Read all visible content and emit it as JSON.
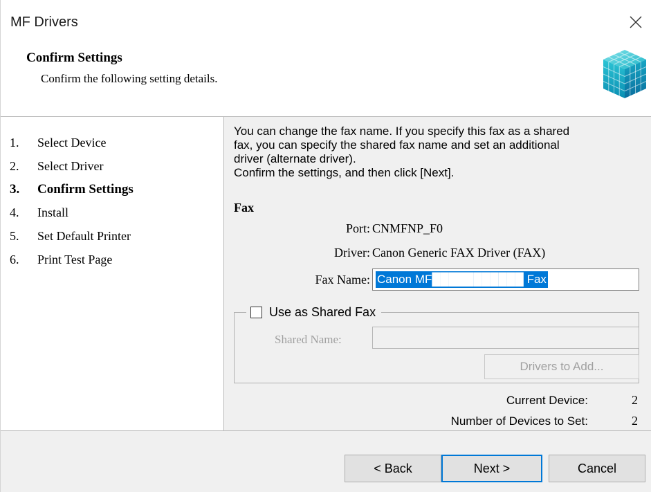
{
  "window": {
    "title": "MF Drivers"
  },
  "header": {
    "title": "Confirm Settings",
    "subtitle": "Confirm the following setting details."
  },
  "steps": [
    {
      "num": "1.",
      "label": "Select Device",
      "active": false
    },
    {
      "num": "2.",
      "label": "Select Driver",
      "active": false
    },
    {
      "num": "3.",
      "label": "Confirm Settings",
      "active": true
    },
    {
      "num": "4.",
      "label": "Install",
      "active": false
    },
    {
      "num": "5.",
      "label": "Set Default Printer",
      "active": false
    },
    {
      "num": "6.",
      "label": "Print Test Page",
      "active": false
    }
  ],
  "content": {
    "intro_line1": "You can change the fax name. If you specify this fax as a shared",
    "intro_line2": "fax, you can specify the shared fax name and set an additional",
    "intro_line3": "driver (alternate driver).",
    "intro_line4": "Confirm the settings, and then click [Next].",
    "fax_heading": "Fax",
    "port_label": "Port:",
    "port_value": "CNMFNP_F0",
    "driver_label": "Driver:",
    "driver_value": "Canon Generic FAX Driver (FAX)",
    "fax_name_label": "Fax Name:",
    "fax_name_value": "Canon MF███████████ Fax",
    "shared_checkbox_label": "Use as Shared Fax",
    "shared_checked": false,
    "shared_name_label": "Shared Name:",
    "shared_name_value": "",
    "drivers_to_add_label": "Drivers to Add...",
    "current_device_label": "Current Device:",
    "current_device_value": "2",
    "num_devices_label": "Number of Devices to Set:",
    "num_devices_value": "2"
  },
  "footer": {
    "back_label": "< Back",
    "next_label": "Next >",
    "cancel_label": "Cancel"
  },
  "colors": {
    "selection": "#0078d7",
    "panel": "#f0f0f0",
    "accent_logo": "#1fb7c9"
  }
}
